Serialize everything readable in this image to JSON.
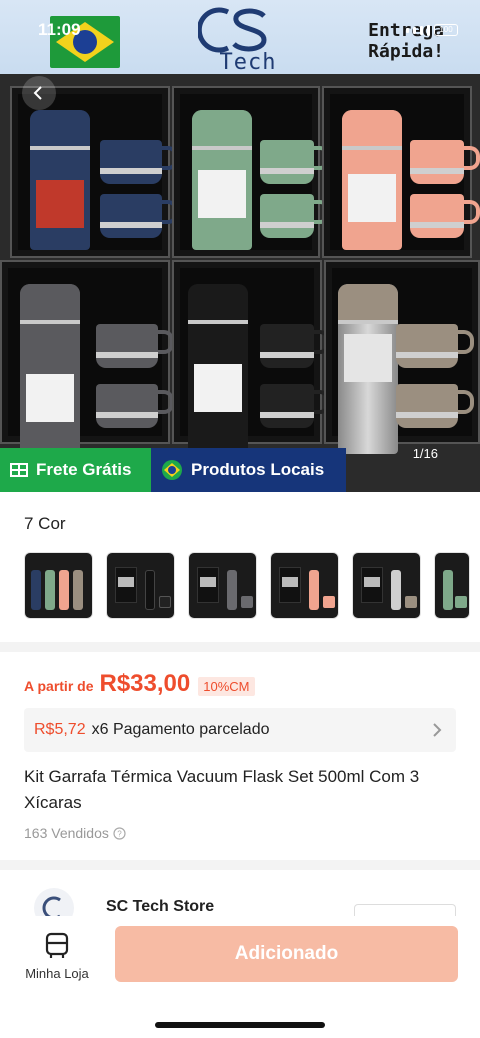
{
  "status_bar": {
    "time": "11:09",
    "battery": "100"
  },
  "banner": {
    "logo_text": "Tech",
    "promo": "Entrega Rápida!"
  },
  "gallery": {
    "page_indicator": "1/16"
  },
  "chips": {
    "free_shipping": "Frete Grátis",
    "local_products": "Produtos Locais"
  },
  "colors": {
    "title": "7 Cor"
  },
  "price": {
    "prefix": "A partir de",
    "value": "R$33,00",
    "badge": "10%CM"
  },
  "installment": {
    "amount": "R$5,72",
    "text": "x6 Pagamento parcelado"
  },
  "product": {
    "title": "Kit Garrafa Térmica Vacuum Flask Set 500ml Com 3 Xícaras",
    "sold": "163 Vendidos"
  },
  "store": {
    "name": "SC Tech Store"
  },
  "bottom_bar": {
    "shop_label": "Minha Loja",
    "add_label": "Adicionado"
  },
  "theme": {
    "accent": "#ee4d2d",
    "add_button": "#f7bba4",
    "free_shipping_bg": "#1ea94a",
    "local_bg": "#16357a"
  }
}
